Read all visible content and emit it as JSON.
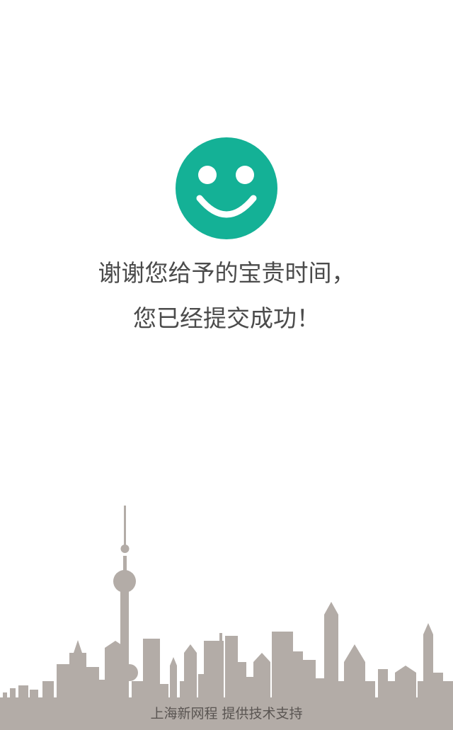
{
  "icon": "smiley-face-icon",
  "colors": {
    "accent": "#14b196",
    "text": "#4b4b4b",
    "skyline": "#b3aca7",
    "footer_text": "#5a5552"
  },
  "message": {
    "line1": "谢谢您给予的宝贵时间，",
    "line2": "您已经提交成功！"
  },
  "footer": {
    "text": "上海新网程 提供技术支持"
  }
}
